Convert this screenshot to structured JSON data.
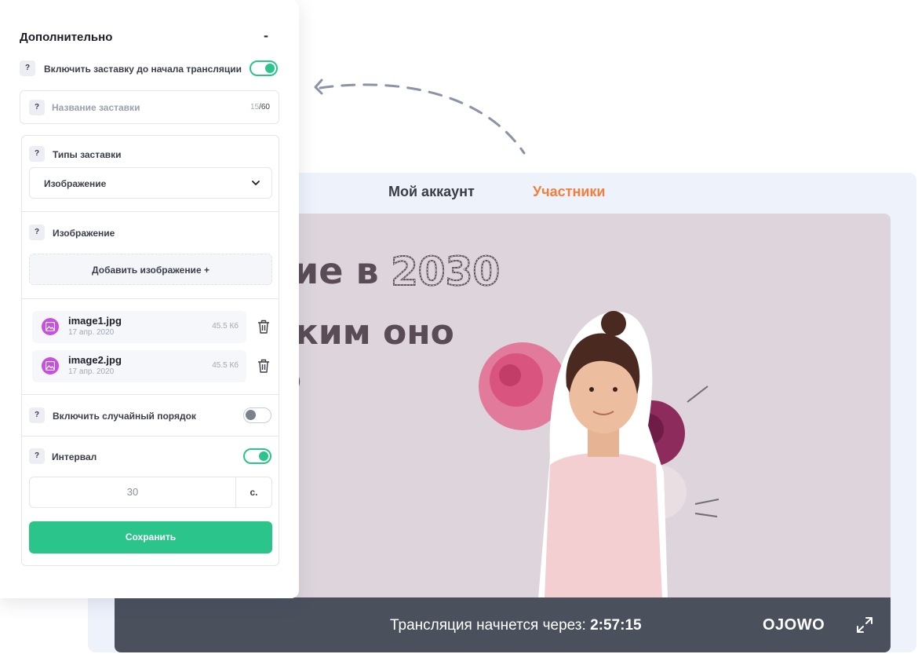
{
  "panel": {
    "title": "Дополнительно",
    "collapse_label": "-",
    "help_label": "?",
    "enable_splash": {
      "label": "Включить заставку до начала трансляции",
      "on": true
    },
    "splash_name": {
      "placeholder": "Название заставки",
      "current_count": "15",
      "max_count": "/60"
    },
    "splash_type": {
      "label": "Типы заставки",
      "value": "Изображение"
    },
    "image_section": {
      "label": "Изображение",
      "add_button": "Добавить изображение +"
    },
    "files": [
      {
        "name": "image1.jpg",
        "date": "17 апр. 2020",
        "size": "45.5 Кб"
      },
      {
        "name": "image2.jpg",
        "date": "17 апр. 2020",
        "size": "45.5 Кб"
      }
    ],
    "random_order": {
      "label": "Включить случайный порядок",
      "on": false
    },
    "interval": {
      "label": "Интервал",
      "on": true,
      "value": "30",
      "unit": "с."
    },
    "save_button": "Сохранить"
  },
  "stream": {
    "tabs": {
      "account": "Мой аккаунт",
      "members": "Участники"
    },
    "slide": {
      "line1": "ие в",
      "year": "2030",
      "line2": "ким оно",
      "line3": ")"
    },
    "countdown_label": "Трансляция начнется через:",
    "countdown_time": "2:57:15",
    "brand": "OJOWO"
  },
  "colors": {
    "accent_green": "#2bc48a",
    "accent_orange": "#f47f3c",
    "file_icon": "#c94fe0",
    "player_bar": "#4b505d"
  },
  "icons": [
    "fullscreen-icon",
    "trash-icon",
    "chevron-down-icon",
    "image-file-icon",
    "help-icon",
    "dashed-arrow-icon"
  ]
}
